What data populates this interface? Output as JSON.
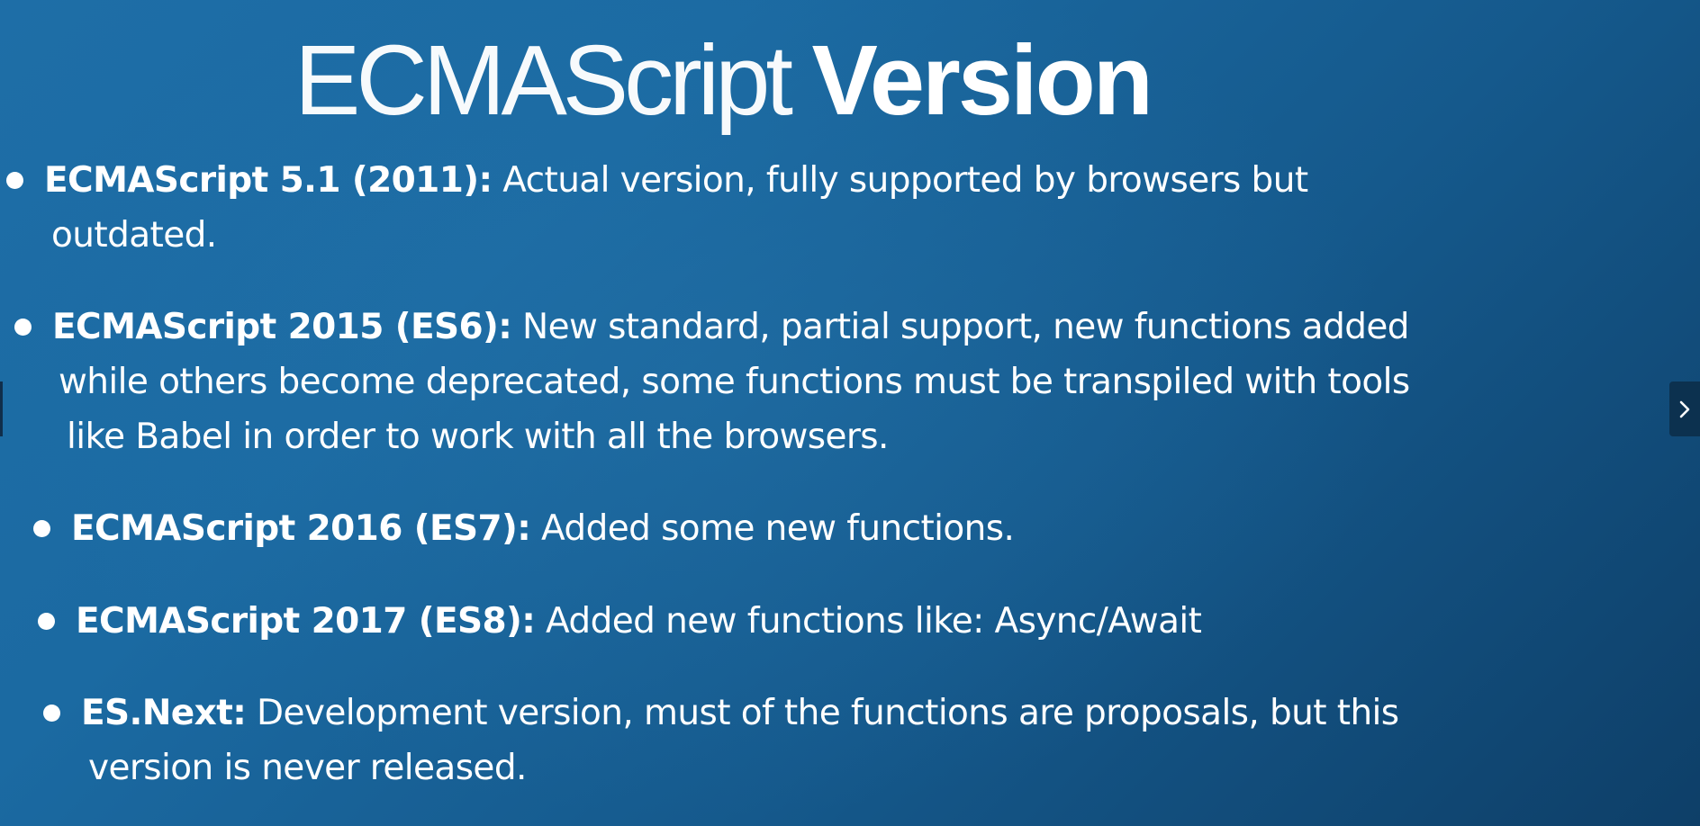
{
  "slide": {
    "title_light": "ECMAScript",
    "title_bold": "Version"
  },
  "bullets": [
    {
      "term": "ECMAScript 5.1 (2011):",
      "text": " Actual version, fully supported by browsers but",
      "continuation": [
        "outdated."
      ]
    },
    {
      "term": "ECMAScript 2015 (ES6):",
      "text": " New standard, partial support, new functions added",
      "continuation": [
        "while others become deprecated, some functions must be transpiled with tools",
        "like Babel in order to work with all the browsers."
      ]
    },
    {
      "term": "ECMAScript 2016 (ES7):",
      "text": " Added some new functions.",
      "continuation": []
    },
    {
      "term": "ECMAScript 2017 (ES8):",
      "text": " Added new functions like: Async/Await",
      "continuation": []
    },
    {
      "term": "ES.Next:",
      "text": " Development version, must of the functions are proposals, but this",
      "continuation": [
        "version is never released."
      ]
    }
  ],
  "navigation": {
    "next_icon": "chevron-right-icon"
  },
  "colors": {
    "background_start": "#1e6ea7",
    "background_end": "#0e3f68",
    "text": "#ffffff"
  }
}
